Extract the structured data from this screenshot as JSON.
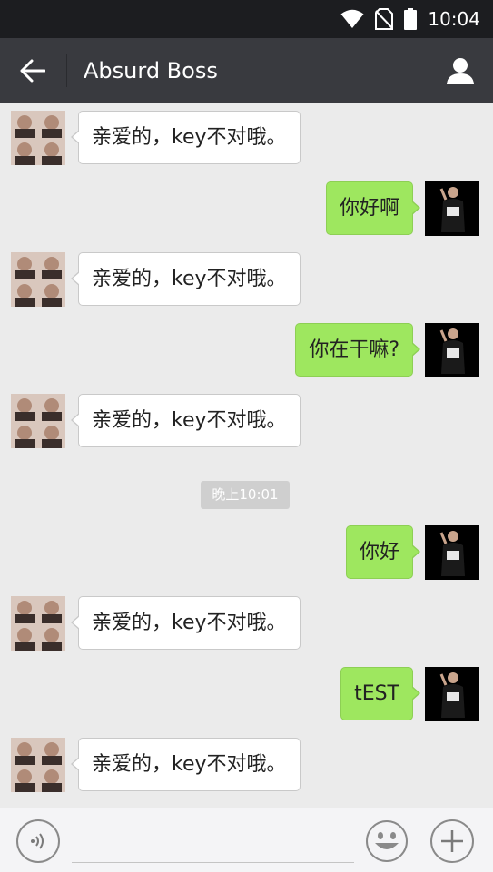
{
  "status_bar": {
    "time": "10:04",
    "icons": [
      "wifi-icon",
      "no-sim-icon",
      "battery-icon"
    ]
  },
  "header": {
    "title": "Absurd Boss",
    "back_icon": "arrow-left-icon",
    "profile_icon": "person-icon"
  },
  "messages": [
    {
      "side": "left",
      "text": "亲爱的，key不对哦。"
    },
    {
      "side": "right",
      "text": "你好啊"
    },
    {
      "side": "left",
      "text": "亲爱的，key不对哦。"
    },
    {
      "side": "right",
      "text": "你在干嘛?"
    },
    {
      "side": "left",
      "text": "亲爱的，key不对哦。"
    },
    {
      "side": "right",
      "text": "你好"
    },
    {
      "side": "left",
      "text": "亲爱的，key不对哦。"
    },
    {
      "side": "right",
      "text": "tEST"
    },
    {
      "side": "left",
      "text": "亲爱的，key不对哦。"
    }
  ],
  "timestamp": "晚上10:01",
  "input": {
    "value": "",
    "placeholder": "",
    "voice_icon": "voice-icon",
    "emoji_icon": "emoji-icon",
    "plus_icon": "plus-icon"
  },
  "colors": {
    "status_bar": "#1c1d20",
    "title_bar": "#393a3f",
    "chat_bg": "#ebebeb",
    "sent_bubble": "#9ee75f",
    "received_bubble": "#ffffff",
    "timestamp_bg": "#cfcfcf"
  }
}
